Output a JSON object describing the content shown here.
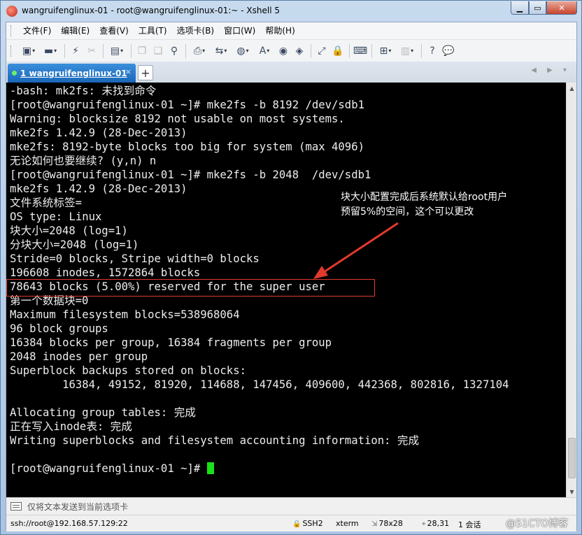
{
  "window": {
    "title": "wangruifenglinux-01 - root@wangruifenglinux-01:~ - Xshell 5",
    "minimize_glyph": "▁",
    "maximize_glyph": "▭",
    "close_glyph": "✕"
  },
  "menu": [
    "文件(F)",
    "编辑(E)",
    "查看(V)",
    "工具(T)",
    "选项卡(B)",
    "窗口(W)",
    "帮助(H)"
  ],
  "toolbar": [
    {
      "icon": "new-session-icon",
      "glyph": "▣",
      "dropdown": true
    },
    {
      "icon": "open-folder-icon",
      "glyph": "▬",
      "dropdown": true
    },
    {
      "icon": "connect-icon",
      "glyph": "⚡",
      "dropdown": false
    },
    {
      "icon": "disconnect-icon",
      "glyph": "✂",
      "dropdown": false,
      "disabled": true
    },
    {
      "icon": "properties-icon",
      "glyph": "▤",
      "dropdown": true
    },
    {
      "icon": "copy-icon",
      "glyph": "❐",
      "dropdown": false,
      "disabled": true
    },
    {
      "icon": "paste-icon",
      "glyph": "❏",
      "dropdown": false,
      "disabled": true
    },
    {
      "icon": "find-icon",
      "glyph": "⚲",
      "dropdown": false
    },
    {
      "icon": "print-icon",
      "glyph": "⎙",
      "dropdown": true
    },
    {
      "icon": "transfer-icon",
      "glyph": "⇆",
      "dropdown": true
    },
    {
      "icon": "globe-icon",
      "glyph": "◍",
      "dropdown": true
    },
    {
      "icon": "font-icon",
      "glyph": "A",
      "dropdown": true
    },
    {
      "icon": "xftp-icon",
      "glyph": "◉",
      "dropdown": false
    },
    {
      "icon": "script-icon",
      "glyph": "◈",
      "dropdown": false
    },
    {
      "icon": "fullscreen-icon",
      "glyph": "⤢",
      "dropdown": false
    },
    {
      "icon": "lock-icon",
      "glyph": "🔒",
      "dropdown": false
    },
    {
      "icon": "keyboard-icon",
      "glyph": "⌨",
      "dropdown": false
    },
    {
      "icon": "add-tab-icon",
      "glyph": "⊞",
      "dropdown": true
    },
    {
      "icon": "layout-icon",
      "glyph": "▥",
      "dropdown": true,
      "disabled": true
    },
    {
      "icon": "help-icon",
      "glyph": "?",
      "dropdown": false
    },
    {
      "icon": "chat-icon",
      "glyph": "💬",
      "dropdown": false
    }
  ],
  "tab": {
    "label": "1 wangruifenglinux-01",
    "close_glyph": "×",
    "add_glyph": "+",
    "nav_glyphs": "◀ ▶ ▾"
  },
  "terminal": {
    "lines": [
      "-bash: mk2fs: 未找到命令",
      "[root@wangruifenglinux-01 ~]# mke2fs -b 8192 /dev/sdb1",
      "Warning: blocksize 8192 not usable on most systems.",
      "mke2fs 1.42.9 (28-Dec-2013)",
      "mke2fs: 8192-byte blocks too big for system (max 4096)",
      "无论如何也要继续? (y,n) n",
      "[root@wangruifenglinux-01 ~]# mke2fs -b 2048  /dev/sdb1",
      "mke2fs 1.42.9 (28-Dec-2013)",
      "文件系统标签=",
      "OS type: Linux",
      "块大小=2048 (log=1)",
      "分块大小=2048 (log=1)",
      "Stride=0 blocks, Stripe width=0 blocks",
      "196608 inodes, 1572864 blocks",
      "78643 blocks (5.00%) reserved for the super user",
      "第一个数据块=0",
      "Maximum filesystem blocks=538968064",
      "96 block groups",
      "16384 blocks per group, 16384 fragments per group",
      "2048 inodes per group",
      "Superblock backups stored on blocks:",
      "        16384, 49152, 81920, 114688, 147456, 409600, 442368, 802816, 1327104",
      "",
      "Allocating group tables: 完成",
      "正在写入inode表: 完成",
      "Writing superblocks and filesystem accounting information: 完成",
      "",
      "[root@wangruifenglinux-01 ~]# "
    ],
    "annotation": "块大小配置完成后系统默认给root用户\n预留5%的空间，这个可以更改",
    "annotation_color": "#e23a2c",
    "cursor_color": "#19e019"
  },
  "sendbar": {
    "placeholder": "仅将文本发送到当前选项卡"
  },
  "status": {
    "connection": "ssh://root@192.168.57.129:22",
    "protocol": "SSH2",
    "terminal_type": "xterm",
    "size": "78x28",
    "position": "28,31",
    "sessions": "1 会话",
    "watermark": "@51CTO博客"
  }
}
